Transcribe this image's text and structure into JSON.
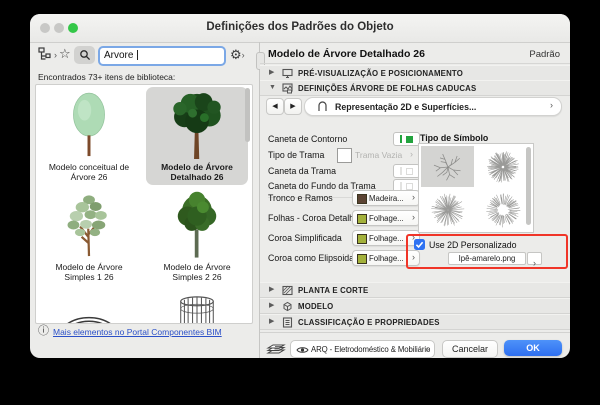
{
  "window": {
    "title": "Definições dos Padrões do Objeto"
  },
  "search": {
    "value": "Árvore",
    "found_text": "Encontrados 73+ itens de biblioteca:"
  },
  "library": {
    "items": [
      {
        "label": "Modelo conceitual de Árvore 26",
        "selected": false
      },
      {
        "label": "Modelo de Árvore Detalhado 26",
        "selected": true
      },
      {
        "label": "Modelo de Árvore Simples 1 26",
        "selected": false
      },
      {
        "label": "Modelo de Árvore Simples 2 26",
        "selected": false
      }
    ],
    "more_link": "Mais elementos no Portal Componentes BIM"
  },
  "header": {
    "title": "Modelo de Árvore Detalhado 26",
    "badge": "Padrão"
  },
  "sections": {
    "preview": "PRÉ-VISUALIZAÇÃO E POSICIONAMENTO",
    "tree": "DEFINIÇÕES ÁRVORE DE FOLHAS CADUCAS",
    "plan": "PLANTA E CORTE",
    "model": "MODELO",
    "classification": "CLASSIFICAÇÃO E PROPRIEDADES"
  },
  "nav": {
    "label": "Representação 2D e Superfícies..."
  },
  "params": {
    "contour_pen": "Caneta de Contorno",
    "fill_type": "Tipo de Trama",
    "fill_type_value": "Trama Vazia",
    "fill_pen": "Caneta da Trama",
    "fill_bg_pen": "Caneta do Fundo da Trama",
    "trunk": "Tronco e Ramos",
    "trunk_value": "Madeira...",
    "leaves": "Folhas - Coroa Detalhada",
    "leaves_value": "Folhage...",
    "crown_simple": "Coroa Simplificada",
    "crown_simple_value": "Folhage...",
    "crown_ellipsoid": "Coroa como Elipsoidal",
    "crown_ellipsoid_value": "Folhage..."
  },
  "symbol": {
    "title": "Tipo de Símbolo",
    "use_custom_label": "Use 2D Personalizado",
    "use_custom_checked": true,
    "filename": "Ipê-amarelo.png"
  },
  "footer": {
    "layer": "ARQ - Eletrodoméstico & Mobiliário",
    "cancel": "Cancelar",
    "ok": "OK"
  },
  "icons": {
    "star": "☆",
    "gear": "⚙",
    "info": "ⓘ",
    "chevron": "›",
    "arrow_left": "◀",
    "arrow_right": "▶",
    "collapsed": "▶",
    "expanded": "▼"
  },
  "colors": {
    "accent_blue": "#2e6ff0",
    "focus_ring": "#7ba8e6",
    "highlight_red": "#f03528",
    "pen_green": "#22a33e",
    "link_blue": "#2b50c8",
    "material_wood": "#5c4434",
    "material_foliage": "#a3b13b",
    "traffic_green": "#34c748",
    "traffic_disabled": "#c8c8c6"
  }
}
